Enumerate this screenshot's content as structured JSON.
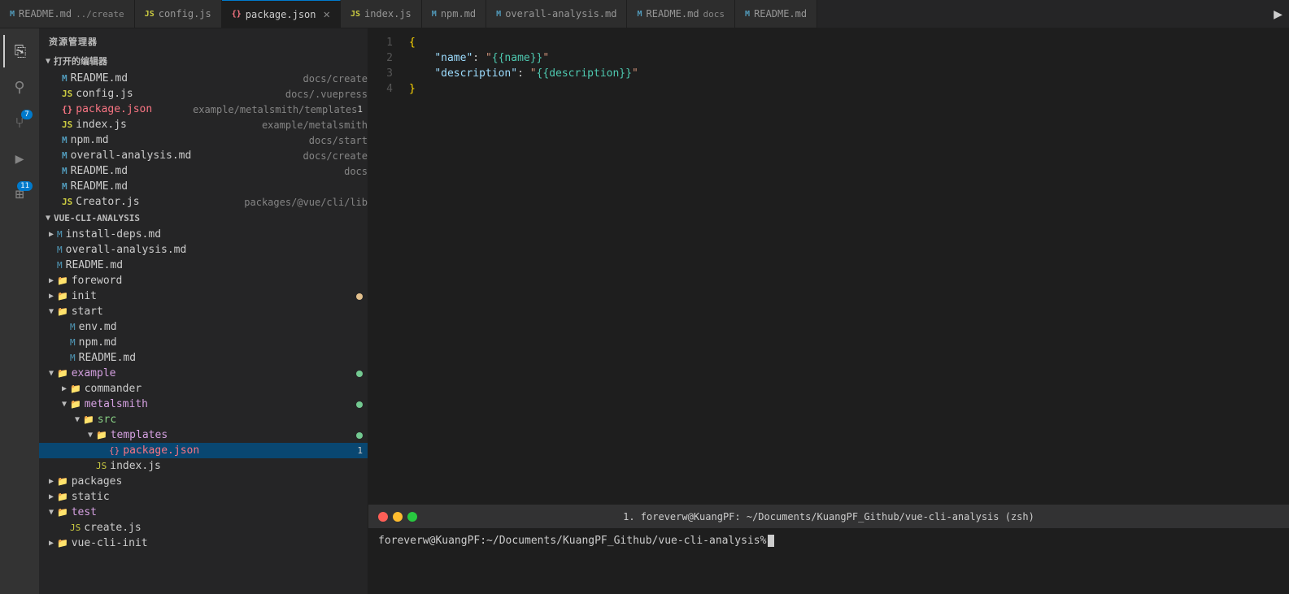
{
  "app": {
    "title": "资源管理器"
  },
  "tabs": [
    {
      "id": "readme-create",
      "icon": "md",
      "label": "README.md",
      "path": "../create",
      "active": false,
      "dirty": false,
      "closable": false
    },
    {
      "id": "config-js",
      "icon": "js",
      "label": "config.js",
      "path": "",
      "active": false,
      "dirty": false,
      "closable": false
    },
    {
      "id": "package-json",
      "icon": "json",
      "label": "package.json",
      "path": "",
      "active": true,
      "dirty": true,
      "closable": true
    },
    {
      "id": "index-js",
      "icon": "js",
      "label": "index.js",
      "path": "",
      "active": false,
      "dirty": false,
      "closable": false
    },
    {
      "id": "npm-md",
      "icon": "md",
      "label": "npm.md",
      "path": "",
      "active": false,
      "dirty": false,
      "closable": false
    },
    {
      "id": "overall-analysis-md",
      "icon": "md",
      "label": "overall-analysis.md",
      "path": "",
      "active": false,
      "dirty": false,
      "closable": false
    },
    {
      "id": "readme-md-docs",
      "icon": "md",
      "label": "README.md",
      "path": "docs",
      "active": false,
      "dirty": false,
      "closable": false
    },
    {
      "id": "readme-md-2",
      "icon": "md",
      "label": "README.md",
      "path": "",
      "active": false,
      "dirty": false,
      "closable": false
    }
  ],
  "sidebar": {
    "header": "资源管理器",
    "opened_editors_label": "打开的编辑器",
    "opened_editors": [
      {
        "icon": "md",
        "name": "README.md",
        "path": "docs/create"
      },
      {
        "icon": "js",
        "name": "config.js",
        "path": "docs/.vuepress"
      },
      {
        "icon": "json-dirty",
        "name": "package.json",
        "path": "example/metalsmith/templates",
        "badge": "1"
      },
      {
        "icon": "js",
        "name": "index.js",
        "path": "example/metalsmith"
      },
      {
        "icon": "md",
        "name": "npm.md",
        "path": "docs/start"
      },
      {
        "icon": "md",
        "name": "overall-analysis.md",
        "path": "docs/create"
      },
      {
        "icon": "md",
        "name": "README.md",
        "path": "docs"
      },
      {
        "icon": "md",
        "name": "README.md",
        "path": ""
      },
      {
        "icon": "js",
        "name": "Creator.js",
        "path": "packages/@vue/cli/lib"
      }
    ],
    "project_label": "VUE-CLI-ANALYSIS",
    "tree": [
      {
        "level": 0,
        "type": "folder",
        "open": true,
        "name": "install-deps.md",
        "icon": "md"
      },
      {
        "level": 0,
        "type": "file",
        "name": "overall-analysis.md",
        "icon": "md"
      },
      {
        "level": 0,
        "type": "file",
        "name": "README.md",
        "icon": "md"
      },
      {
        "level": 0,
        "type": "folder-closed",
        "name": "foreword",
        "icon": "folder"
      },
      {
        "level": 0,
        "type": "folder-closed",
        "name": "init",
        "icon": "folder",
        "dot": "yellow"
      },
      {
        "level": 0,
        "type": "folder-open",
        "name": "start",
        "icon": "folder-open"
      },
      {
        "level": 1,
        "type": "file",
        "name": "env.md",
        "icon": "md"
      },
      {
        "level": 1,
        "type": "file",
        "name": "npm.md",
        "icon": "md"
      },
      {
        "level": 1,
        "type": "file",
        "name": "README.md",
        "icon": "md"
      },
      {
        "level": 0,
        "type": "folder-open",
        "name": "example",
        "icon": "folder-open",
        "dot": "green"
      },
      {
        "level": 1,
        "type": "folder-closed",
        "name": "commander",
        "icon": "folder"
      },
      {
        "level": 1,
        "type": "folder-open",
        "name": "metalsmith",
        "icon": "folder-special",
        "dot": "green"
      },
      {
        "level": 2,
        "type": "folder-open",
        "name": "src",
        "icon": "folder-src"
      },
      {
        "level": 3,
        "type": "folder-open",
        "name": "templates",
        "icon": "folder-special",
        "dot": "green"
      },
      {
        "level": 4,
        "type": "file",
        "name": "package.json",
        "icon": "json-dirty",
        "badge": "1",
        "selected": true
      },
      {
        "level": 3,
        "type": "file",
        "name": "index.js",
        "icon": "js"
      },
      {
        "level": 0,
        "type": "folder-closed",
        "name": "packages",
        "icon": "folder"
      },
      {
        "level": 0,
        "type": "folder-closed",
        "name": "static",
        "icon": "folder"
      },
      {
        "level": 0,
        "type": "folder-open",
        "name": "test",
        "icon": "folder-special"
      },
      {
        "level": 1,
        "type": "file",
        "name": "create.js",
        "icon": "js"
      },
      {
        "level": 0,
        "type": "folder-closed",
        "name": "vue-cli-init",
        "icon": "folder"
      }
    ]
  },
  "editor": {
    "lines": [
      {
        "num": "1",
        "content": "{"
      },
      {
        "num": "2",
        "content": "    \"name\": \"{{name}}\","
      },
      {
        "num": "3",
        "content": "    \"description\": \"{{description}}\""
      },
      {
        "num": "4",
        "content": "}"
      }
    ]
  },
  "terminal": {
    "title": "1. foreverw@KuangPF: ~/Documents/KuangPF_Github/vue-cli-analysis (zsh)",
    "prompt": "foreverw@KuangPF:~/Documents/KuangPF_Github/vue-cli-analysis% "
  },
  "activity_bar": {
    "icons": [
      {
        "name": "files",
        "symbol": "⎘",
        "active": true,
        "badge": null
      },
      {
        "name": "search",
        "symbol": "🔍",
        "active": false,
        "badge": null
      },
      {
        "name": "source-control",
        "symbol": "⎇",
        "active": false,
        "badge": "7"
      },
      {
        "name": "debug",
        "symbol": "▷",
        "active": false,
        "badge": null
      },
      {
        "name": "extensions",
        "symbol": "⊞",
        "active": false,
        "badge": "11"
      }
    ]
  }
}
